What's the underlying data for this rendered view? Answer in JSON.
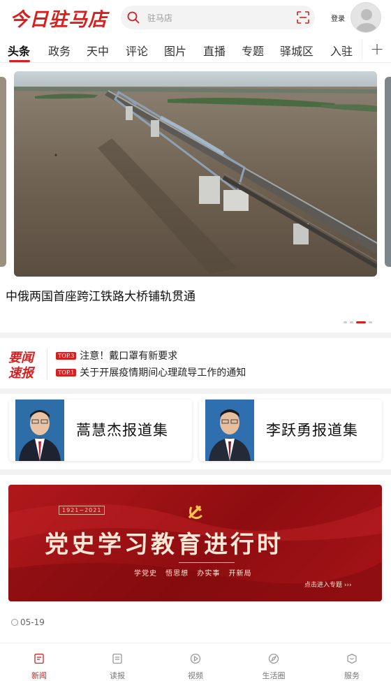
{
  "header": {
    "logo": "今日驻马店",
    "search_placeholder": "驻马店",
    "login_label": "登录"
  },
  "tabs": [
    "头条",
    "政务",
    "天中",
    "评论",
    "图片",
    "直播",
    "专题",
    "驿城区",
    "入驻"
  ],
  "carousel": {
    "headline": "中俄两国首座跨江铁路大桥铺轨贯通",
    "dot_count": 4,
    "active_dot": 2
  },
  "news_flash": {
    "title_line1": "要闻",
    "title_line2": "速报",
    "items": [
      {
        "badge": "TOP.3",
        "text": "注意！戴口罩有新要求"
      },
      {
        "badge": "TOP.1",
        "text": "关于开展疫情期间心理疏导工作的通知"
      }
    ]
  },
  "report_cards": [
    {
      "title": "蒿慧杰报道集"
    },
    {
      "title": "李跃勇报道集"
    }
  ],
  "banner": {
    "years": "1921~2021",
    "title": "党史学习教育进行时",
    "subs": "学党史 悟思想 办实事 开新局",
    "cta": "点击进入专题 ›››",
    "date": "05-19"
  },
  "bottom_nav": [
    {
      "label": "新闻",
      "icon": "news-icon",
      "active": true
    },
    {
      "label": "读报",
      "icon": "newspaper-icon",
      "active": false
    },
    {
      "label": "视频",
      "icon": "play-icon",
      "active": false
    },
    {
      "label": "生活圈",
      "icon": "compass-icon",
      "active": false
    },
    {
      "label": "服务",
      "icon": "service-icon",
      "active": false
    }
  ],
  "colors": {
    "accent": "#d71f1f",
    "banner": "#a51317"
  }
}
